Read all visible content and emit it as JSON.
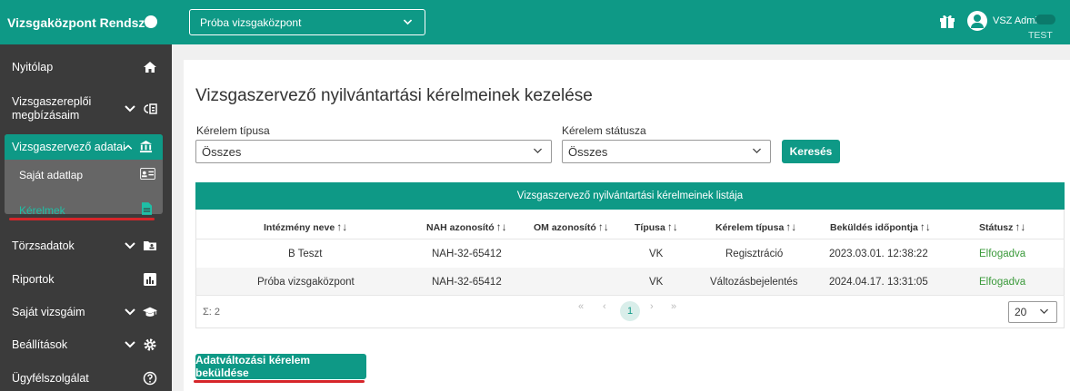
{
  "app": {
    "brand": "Vizsgaközpont Rendszer"
  },
  "topbar": {
    "center_select": "Próba vizsgaközpont",
    "user_name": "VSZ Admin",
    "env": "TEST"
  },
  "sidebar": {
    "items": [
      {
        "label": "Nyitólap"
      },
      {
        "label": "Vizsgaszereplői megbízásaim"
      },
      {
        "label": "Vizsgaszervező adatai"
      },
      {
        "label": "Törzsadatok"
      },
      {
        "label": "Riportok"
      },
      {
        "label": "Saját vizsgáim"
      },
      {
        "label": "Beállítások"
      },
      {
        "label": "Ügyfélszolgálat"
      }
    ],
    "sub_items": [
      {
        "label": "Saját adatlap"
      },
      {
        "label": "Kérelmek"
      }
    ]
  },
  "main": {
    "title": "Vizsgaszervező nyilvántartási kérelmeinek kezelése",
    "filters": {
      "type_label": "Kérelem típusa",
      "type_value": "Összes",
      "status_label": "Kérelem státusza",
      "status_value": "Összes",
      "search_label": "Keresés"
    },
    "table": {
      "title": "Vizsgaszervező nyilvántartási kérelmeinek listája",
      "columns": [
        "Intézmény neve",
        "NAH azonosító",
        "OM azonosító",
        "Típusa",
        "Kérelem típusa",
        "Beküldés időpontja",
        "Státusz"
      ],
      "rows": [
        [
          "B Teszt",
          "NAH-32-65412",
          "",
          "VK",
          "Regisztráció",
          "2023.03.01. 12:38:22",
          "Elfogadva"
        ],
        [
          "Próba vizsgaközpont",
          "NAH-32-65412",
          "",
          "VK",
          "Változásbejelentés",
          "2024.04.17. 13:31:05",
          "Elfogadva"
        ]
      ],
      "sum": "Σ: 2",
      "current_page": "1",
      "page_size": "20"
    },
    "submit_label": "Adatváltozási kérelem beküldése"
  },
  "colors": {
    "accent": "#0e9986",
    "sidebar": "#3b3b3b",
    "underline": "#d6262a",
    "status_ok": "#3b9a3b"
  }
}
